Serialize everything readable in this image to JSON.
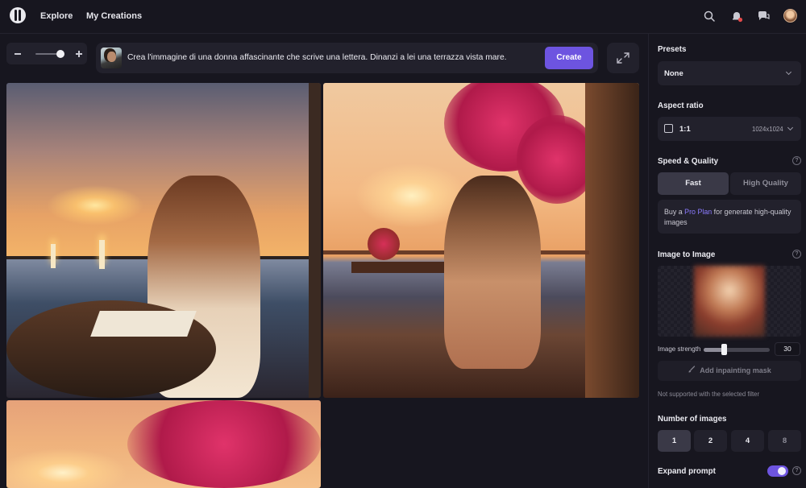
{
  "nav": {
    "explore": "Explore",
    "my_creations": "My Creations"
  },
  "icons": {
    "logo": "app-logo",
    "search": "search-icon",
    "notifications": "bell-icon",
    "chat": "chat-icon",
    "zoom_out": "minus-icon",
    "zoom_in": "plus-icon",
    "expand": "expand-icon",
    "brush": "brush-icon"
  },
  "zoom": {
    "level": 0.72
  },
  "prompt": {
    "text": "Crea l'immagine di una donna affascinante che scrive una lettera. Dinanzi a lei una terrazza vista mare.",
    "create_label": "Create"
  },
  "panel": {
    "presets_label": "Presets",
    "presets_value": "None",
    "aspect_label": "Aspect ratio",
    "aspect_value": "1:1",
    "aspect_dims": "1024x1024",
    "speed_label": "Speed & Quality",
    "speed_options": [
      "Fast",
      "High Quality"
    ],
    "speed_selected": "Fast",
    "promo_prefix": "Buy a ",
    "promo_link": "Pro Plan",
    "promo_suffix": " for generate high-quality images",
    "i2i_label": "Image to Image",
    "strength_label": "Image strength",
    "strength_value": "30",
    "inpaint_label": "Add inpainting mask",
    "note": "Not supported with the selected filter",
    "num_label": "Number of images",
    "num_options": [
      "1",
      "2",
      "4",
      "8"
    ],
    "num_selected": "1",
    "expand_label": "Expand prompt",
    "expand_on": true,
    "help": "?"
  },
  "colors": {
    "accent": "#6d54e0",
    "bg": "#17161f",
    "surface": "#22212c",
    "link": "#8b7bff"
  }
}
